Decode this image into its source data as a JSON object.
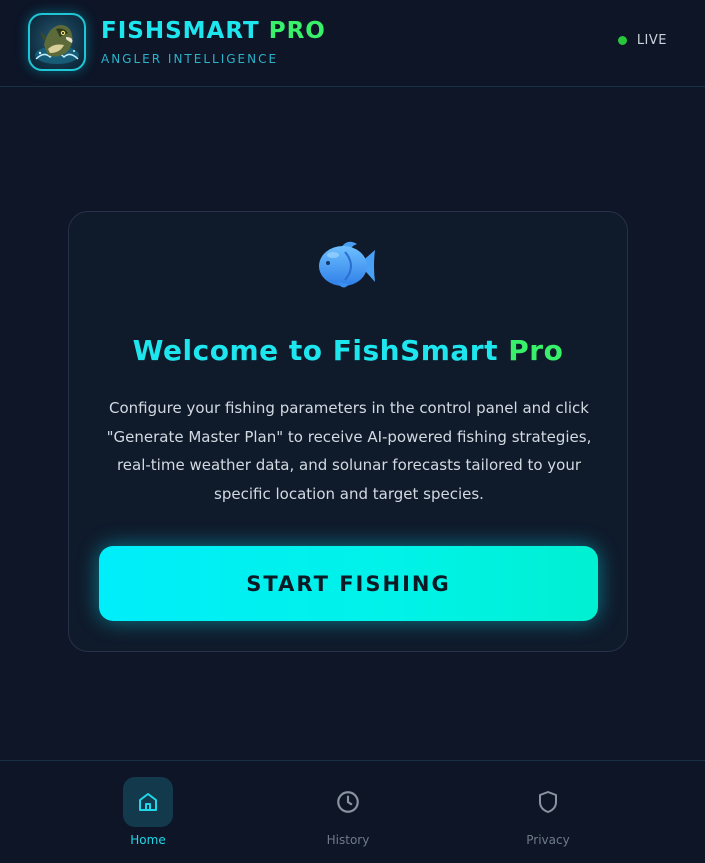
{
  "header": {
    "brand_main": "FISHSMART",
    "brand_pro": "PRO",
    "subtitle": "ANGLER INTELLIGENCE",
    "status_label": "LIVE",
    "status_color": "#29c53c",
    "logo_icon": "bass-fish-logo"
  },
  "welcome": {
    "icon": "fish-icon",
    "title_main": "Welcome to FishSmart",
    "title_pro": "Pro",
    "description": "Configure your fishing parameters in the control panel and click \"Generate Master Plan\" to receive AI-powered fishing strategies, real-time weather data, and solunar forecasts tailored to your specific location and target species.",
    "button_label": "START FISHING"
  },
  "nav": {
    "items": [
      {
        "label": "Home",
        "icon": "home-icon",
        "active": true
      },
      {
        "label": "History",
        "icon": "clock-icon",
        "active": false
      },
      {
        "label": "Privacy",
        "icon": "shield-icon",
        "active": false
      }
    ]
  },
  "colors": {
    "accent_cyan": "#1ee6ee",
    "accent_green": "#39f06a",
    "background": "#0e1628"
  }
}
